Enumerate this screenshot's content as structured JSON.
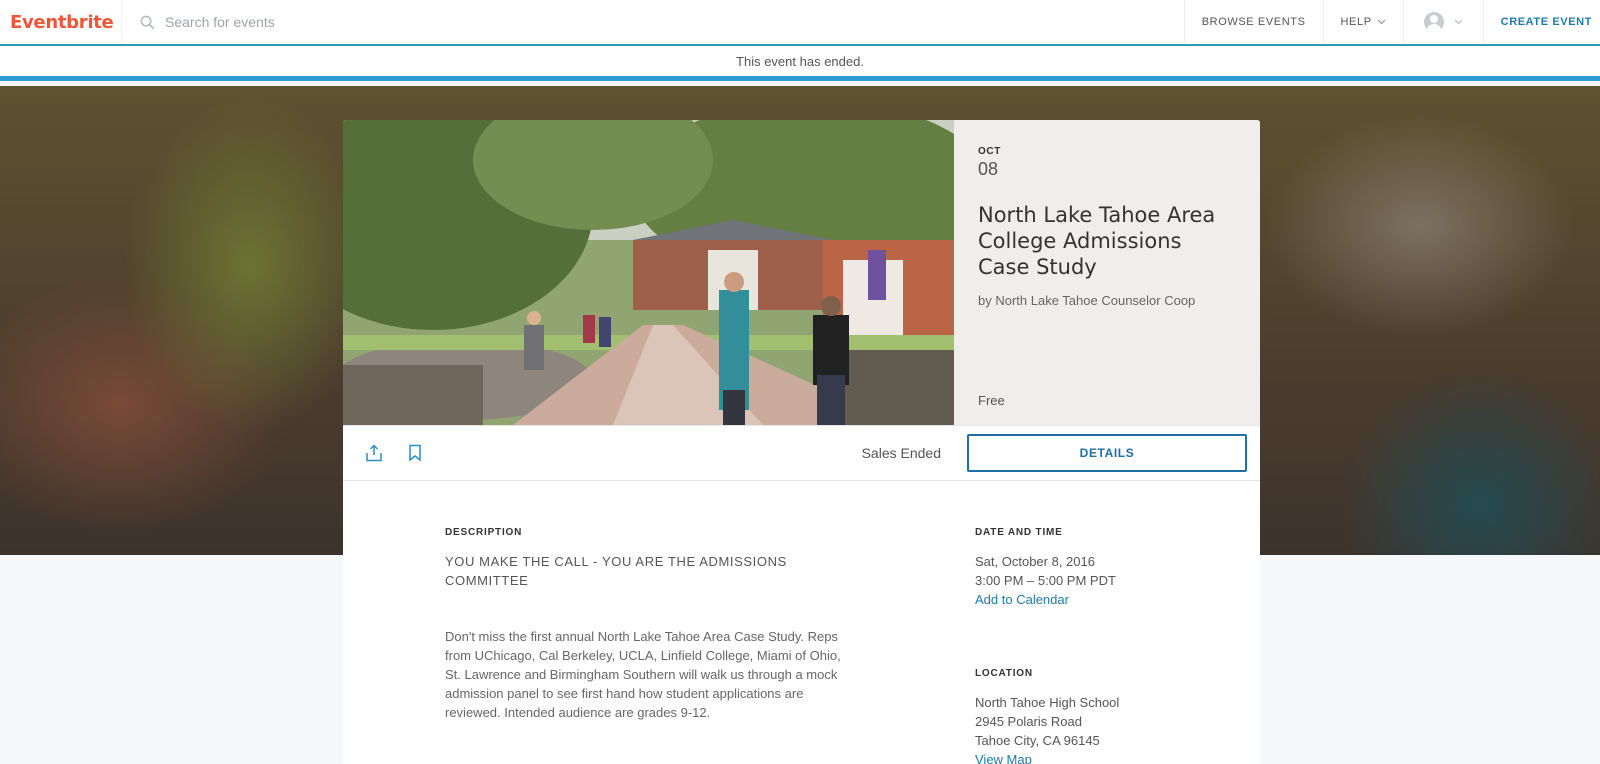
{
  "header": {
    "logo": "Eventbrite",
    "search_placeholder": "Search for events",
    "nav": {
      "browse": "BROWSE EVENTS",
      "help": "HELP",
      "create": "CREATE EVENT"
    }
  },
  "banner": {
    "text": "This event has ended."
  },
  "event": {
    "month": "OCT",
    "day": "08",
    "title": "North Lake Tahoe Area College Admissions Case Study",
    "organizer": "by North Lake Tahoe Counselor Coop",
    "price": "Free",
    "sales_status": "Sales Ended",
    "details_label": "DETAILS"
  },
  "description": {
    "label": "DESCRIPTION",
    "heading": "YOU MAKE THE CALL - YOU ARE THE ADMISSIONS COMMITTEE",
    "body": "Don't miss the first annual North Lake Tahoe Area Case Study. Reps from UChicago, Cal Berkeley, UCLA, Linfield College, Miami of Ohio, St. Lawrence and Birmingham Southern will walk us through a mock admission panel to see first hand how student applications are reviewed. Intended audience are grades 9-12."
  },
  "date_time": {
    "label": "DATE AND TIME",
    "date": "Sat, October 8, 2016",
    "time": "3:00 PM – 5:00 PM PDT",
    "add_to_calendar": "Add to Calendar"
  },
  "location": {
    "label": "LOCATION",
    "venue": "North Tahoe High School",
    "street": "2945 Polaris Road",
    "city": "Tahoe City, CA 96145",
    "view_map": "View Map"
  },
  "colors": {
    "brand": "#f05537",
    "accent_blue": "#1f6fa5",
    "banner_stripe": "#2d9bd6"
  }
}
